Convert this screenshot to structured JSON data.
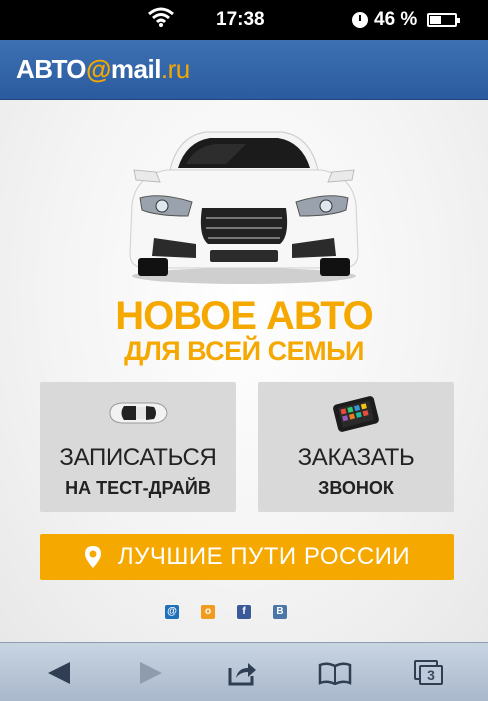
{
  "status_bar": {
    "time": "17:38",
    "battery": "46 %",
    "battery_level": 0.46
  },
  "header": {
    "logo_main": "АВТО",
    "logo_at": "@",
    "logo_mail": "mail",
    "logo_ru": ".ru"
  },
  "hero": {
    "headline": "НОВОЕ АВТО",
    "subheadline": "ДЛЯ ВСЕЙ СЕМЬИ"
  },
  "tiles": {
    "test_drive": {
      "line1": "ЗАПИСАТЬСЯ",
      "line2": "НА ТЕСТ-ДРАЙВ",
      "icon": "car-icon"
    },
    "callback": {
      "line1": "ЗАКАЗАТЬ",
      "line2": "ЗВОНОК",
      "icon": "phone-icon"
    }
  },
  "routes_button": {
    "label": "ЛУЧШИЕ ПУТИ РОССИИ",
    "icon": "location-pin-icon"
  },
  "social": [
    {
      "name": "mail-ru-icon",
      "glyph": "@",
      "color": "#1f6fba"
    },
    {
      "name": "odnoklassniki-icon",
      "glyph": "ok",
      "color": "#f29c1f"
    },
    {
      "name": "facebook-icon",
      "glyph": "f",
      "color": "#3b5998"
    },
    {
      "name": "vkontakte-icon",
      "glyph": "B",
      "color": "#4a76a8"
    }
  ],
  "toolbar": {
    "tabs_count": "3"
  },
  "colors": {
    "accent": "#f5a800",
    "header_blue": "#2f63a8",
    "tile_gray": "#d9d9d9"
  }
}
